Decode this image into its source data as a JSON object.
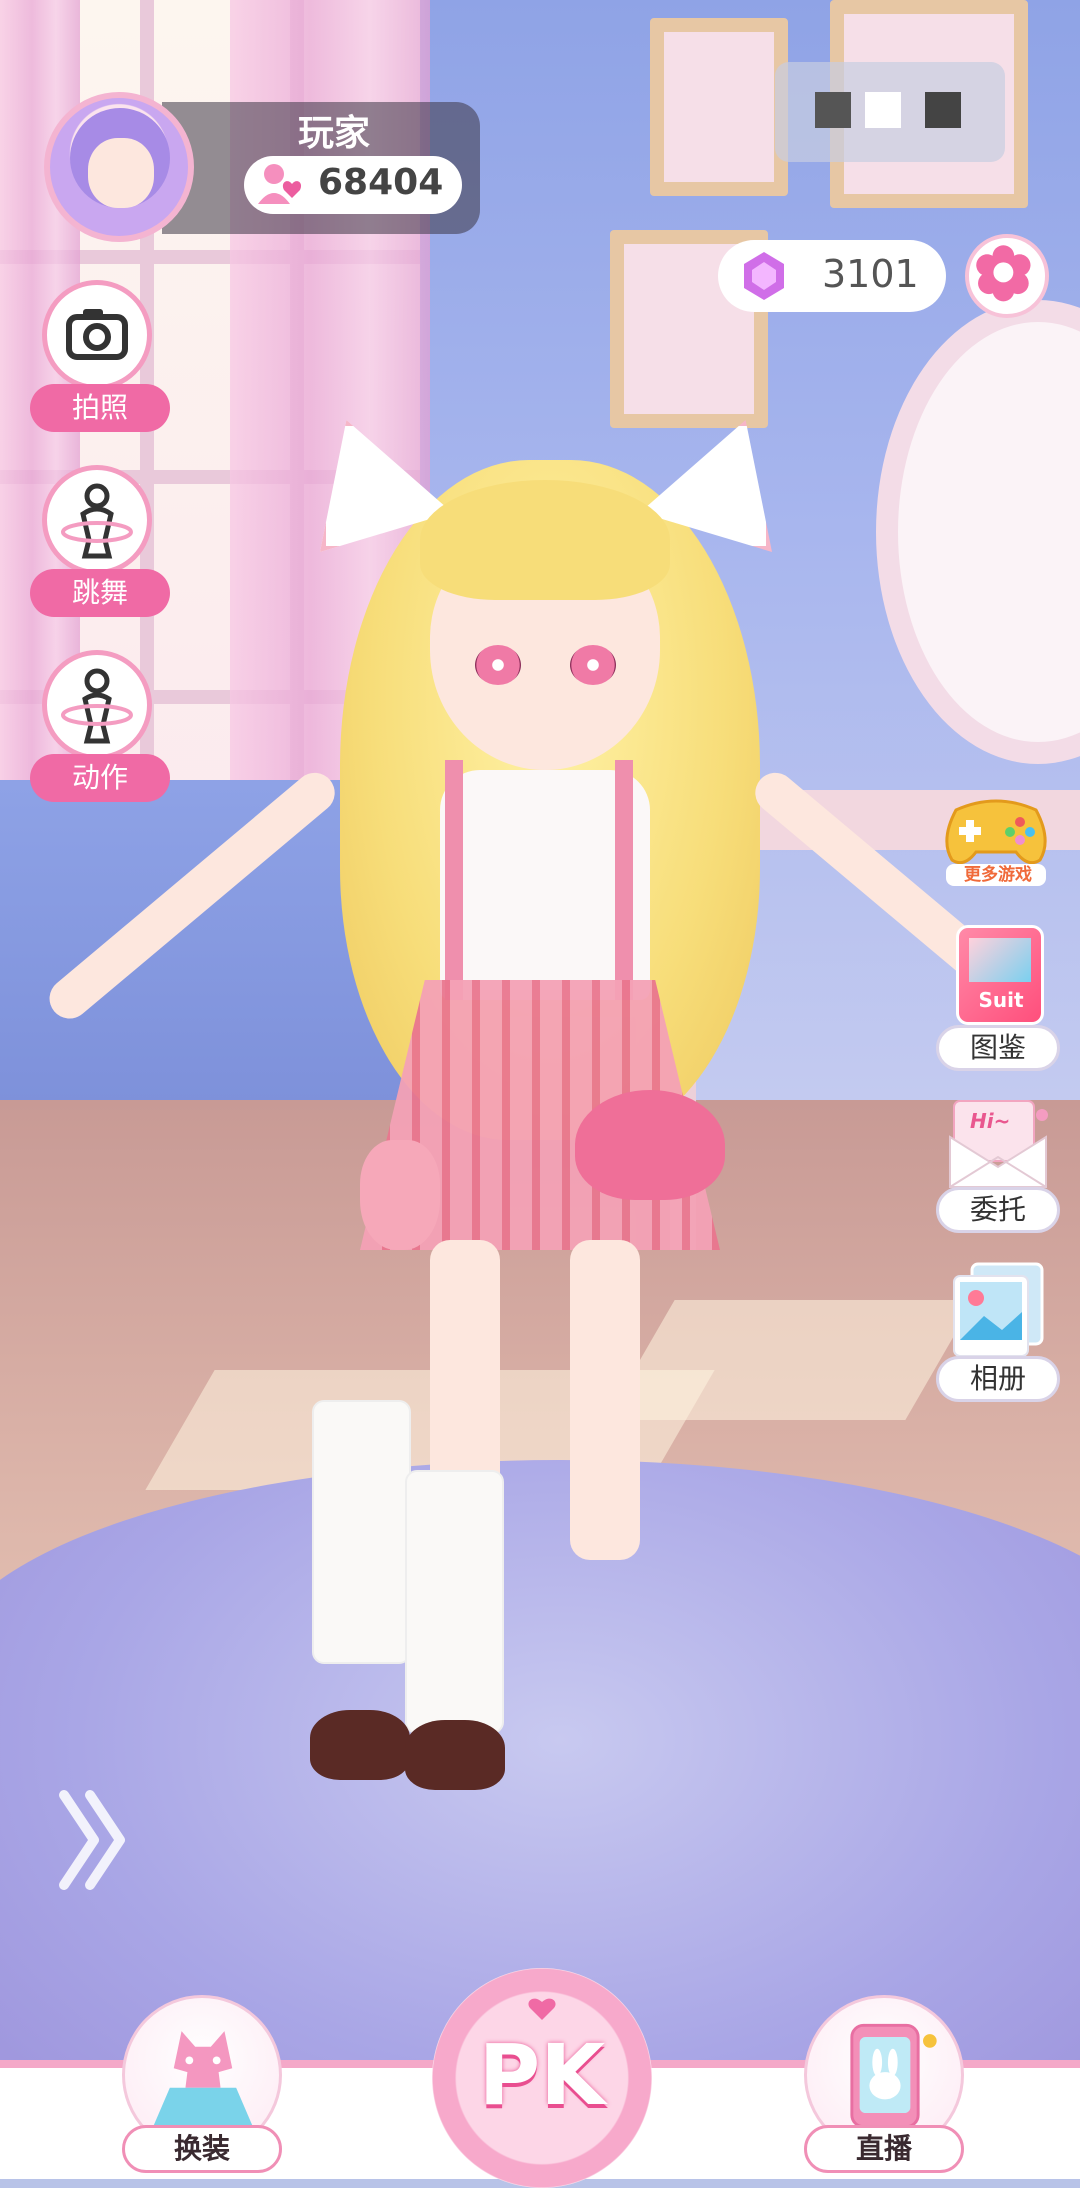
{
  "player": {
    "name": "玩家",
    "popularity": "68404"
  },
  "currency": {
    "gems": "3101"
  },
  "left_actions": [
    {
      "label": "拍照",
      "icon": "camera-icon"
    },
    {
      "label": "跳舞",
      "icon": "dance-icon"
    },
    {
      "label": "动作",
      "icon": "pose-icon"
    }
  ],
  "right_actions": {
    "more_games": "更多游戏",
    "suit_badge": "Suit",
    "items": [
      {
        "label": "图鉴",
        "icon": "collection-icon"
      },
      {
        "label": "委托",
        "icon": "mail-icon"
      },
      {
        "label": "相册",
        "icon": "album-icon"
      }
    ],
    "mail_badge": "Hi~"
  },
  "bottom_nav": {
    "dress_up": "换装",
    "pk": "PK",
    "live": "直播"
  },
  "colors": {
    "accent_pink": "#f06aa5",
    "pk_pink": "#e94f90",
    "label_pill": "#ffffff"
  }
}
